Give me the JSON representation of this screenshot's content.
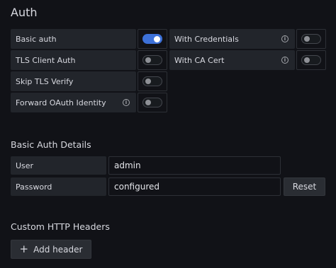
{
  "auth": {
    "title": "Auth",
    "basic_auth": {
      "label": "Basic auth",
      "enabled": true
    },
    "with_credentials": {
      "label": "With Credentials",
      "enabled": false,
      "info_icon": "info-circle"
    },
    "tls_client_auth": {
      "label": "TLS Client Auth",
      "enabled": false
    },
    "with_ca_cert": {
      "label": "With CA Cert",
      "enabled": false,
      "info_icon": "info-circle"
    },
    "skip_tls_verify": {
      "label": "Skip TLS Verify",
      "enabled": false
    },
    "forward_oauth": {
      "label": "Forward OAuth Identity",
      "enabled": false,
      "info_icon": "info-circle"
    }
  },
  "basic_auth_details": {
    "title": "Basic Auth Details",
    "user_label": "User",
    "user_value": "admin",
    "password_label": "Password",
    "password_value": "configured",
    "reset_label": "Reset"
  },
  "custom_headers": {
    "title": "Custom HTTP Headers",
    "add_label": "Add header"
  },
  "colors": {
    "background": "#111217",
    "label_bg": "#22252b",
    "toggle_on": "#3d71d9"
  }
}
